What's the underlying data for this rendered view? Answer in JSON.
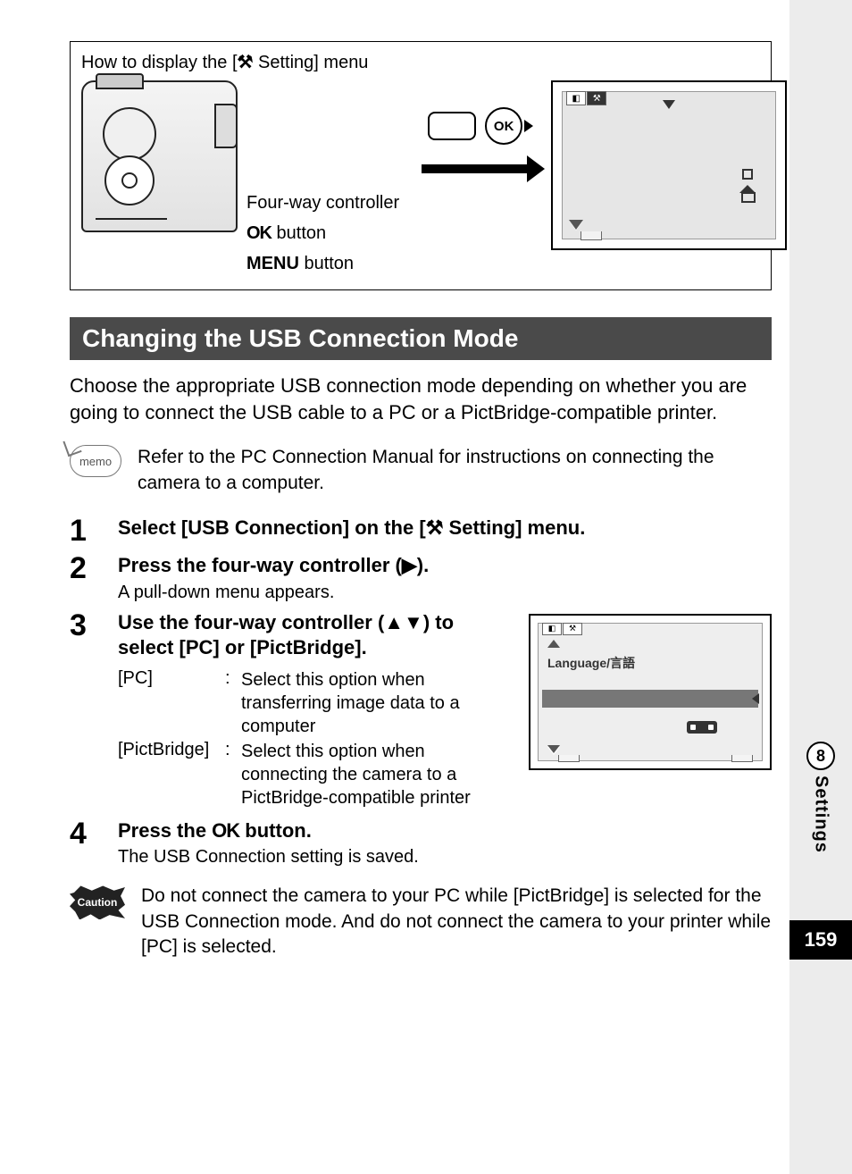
{
  "page_number": "159",
  "tab": {
    "number": "8",
    "label": "Settings"
  },
  "diagram": {
    "title_prefix": "How to display the [",
    "title_suffix": " Setting] menu",
    "tool_glyph": "⚒",
    "labels": {
      "fourway": "Four-way controller",
      "ok_strong": "OK",
      "ok_rest": "  button",
      "menu_strong": "MENU",
      "menu_rest": "  button"
    },
    "ok_button_glyph": "OK"
  },
  "section_heading": "Changing the USB Connection Mode",
  "intro": "Choose the appropriate USB connection mode depending on whether you are going to connect the USB cable to a PC or a PictBridge-compatible printer.",
  "memo": {
    "badge": "memo",
    "text": "Refer to the PC Connection Manual for instructions on connecting the camera to a computer."
  },
  "steps": {
    "s1": {
      "num": "1",
      "title_a": "Select [USB Connection] on the [",
      "title_b": " Setting] menu."
    },
    "s2": {
      "num": "2",
      "title": "Press the four-way controller (▶).",
      "sub": "A pull-down menu appears."
    },
    "s3": {
      "num": "3",
      "title": "Use the four-way controller (▲▼) to select [PC] or [PictBridge].",
      "opts": {
        "pc_k": "[PC]",
        "pc_v": "Select this option when transferring image data to a computer",
        "pb_k": "[PictBridge]",
        "pb_v": "Select this option when connecting the camera to a PictBridge-compatible printer"
      },
      "screen": {
        "lang_label": "Language/言語"
      }
    },
    "s4": {
      "num": "4",
      "title_a": "Press the ",
      "title_ok": "OK",
      "title_b": " button.",
      "sub": "The USB Connection setting is saved."
    }
  },
  "caution": {
    "badge": "Caution",
    "text": "Do not connect the camera to your PC while [PictBridge] is selected for the USB Connection mode. And do not connect the camera to your printer while [PC] is selected."
  }
}
